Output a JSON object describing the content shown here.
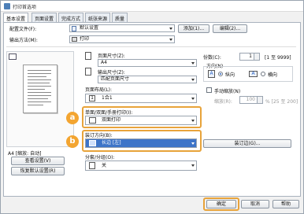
{
  "window": {
    "title": "打印首选项"
  },
  "tabs": [
    "基本设置",
    "页面设置",
    "完成方式",
    "纸张来源",
    "质量"
  ],
  "profile": {
    "label": "配置文件(F):",
    "value": "默认设置",
    "add_label": "添加(1)...",
    "edit_label": "编辑(2)..."
  },
  "output": {
    "label": "输出方法(M):",
    "value": "打印"
  },
  "preview": {
    "caption": "A4 [缩放: 自动]",
    "view_settings_label": "查看设置(V)",
    "restore_defaults_label": "恢复默认设置(R)"
  },
  "page_size": {
    "label": "页面尺寸(Z):",
    "value": "A4"
  },
  "output_size": {
    "label": "输出尺寸(Z):",
    "value": "匹配页面尺寸"
  },
  "page_layout": {
    "label": "页面布局(L):",
    "value": "1合1"
  },
  "duplex": {
    "label": "单面/双面/手册打印(I):",
    "value": "双面打印",
    "badge": "a"
  },
  "binding": {
    "label": "装订方向(B):",
    "value": "长边 [左]",
    "badge": "b",
    "margin_button_label": "装订边(G)..."
  },
  "staple": {
    "label": "分套/分组(O):",
    "value": "关"
  },
  "copies": {
    "label": "份数(C):",
    "value": "1",
    "range": "[1 至 9999]"
  },
  "orientation": {
    "label": "方向(N)",
    "portrait_label": "纵向",
    "landscape_label": "横向",
    "portrait_selected": true
  },
  "manual_scaling": {
    "label": "手动缩放(N)",
    "scaling_label": "缩放(R):",
    "scaling_value": "100",
    "scaling_range": "% [25 至 200]"
  },
  "footer": {
    "ok_label": "确定",
    "cancel_label": "取消",
    "help_label": "帮助"
  },
  "colors": {
    "highlight": "#e8a33a",
    "badge": "#f3a531",
    "accent": "#2b63c5"
  }
}
